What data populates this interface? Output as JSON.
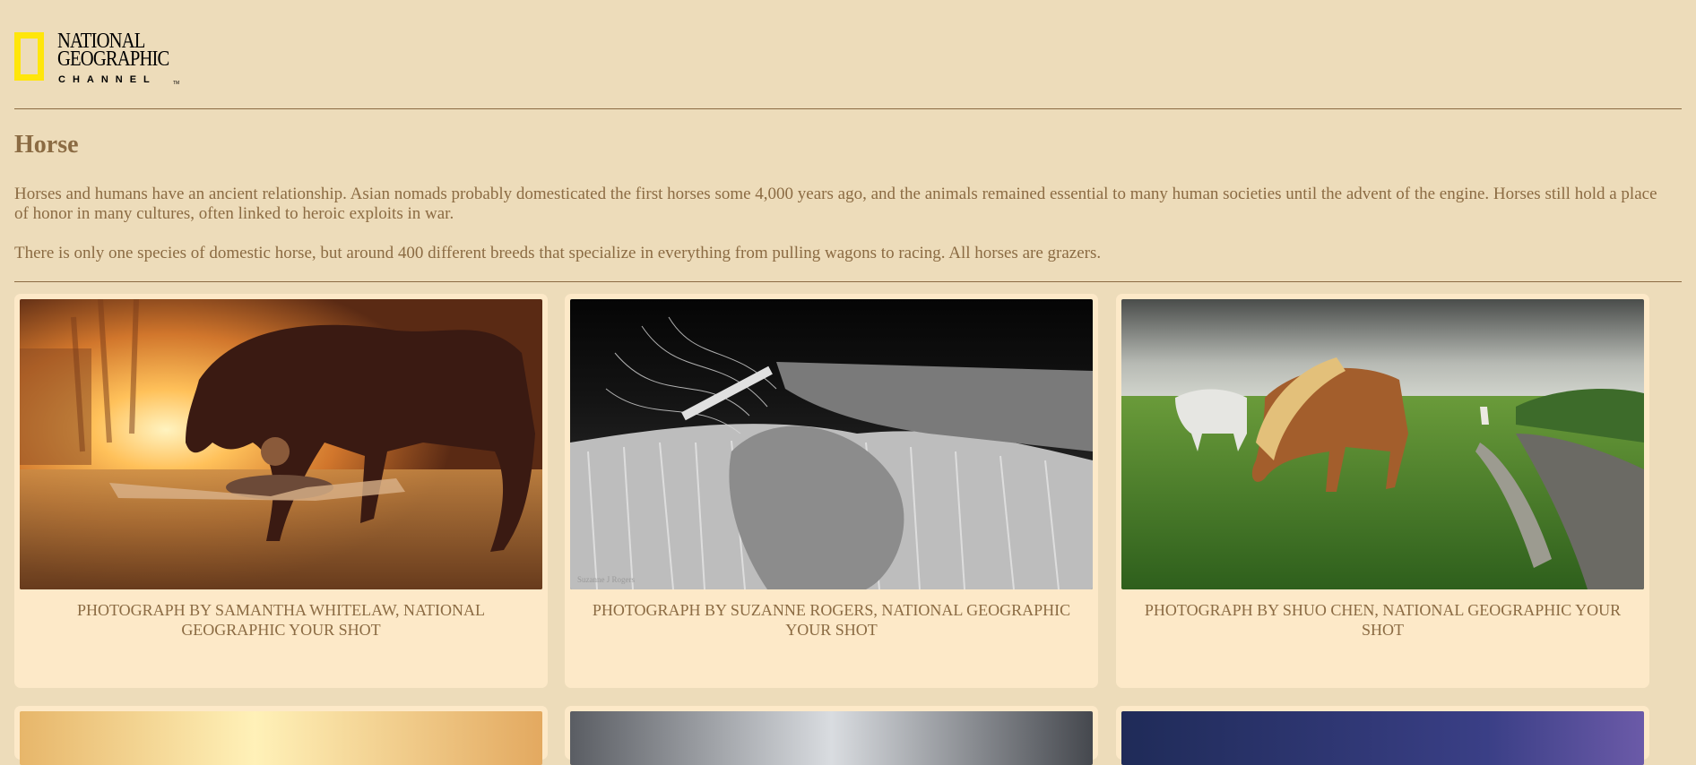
{
  "brand": {
    "line1": "NATIONAL",
    "line2": "GEOGRAPHIC",
    "line3": "CHANNEL",
    "frame_color": "#ffe60a",
    "tm": "TM"
  },
  "header": {
    "title": "Horse"
  },
  "intro": {
    "p1": "Horses and humans have an ancient relationship. Asian nomads probably domesticated the first horses some 4,000 years ago, and the animals remained essential to many human societies until the advent of the engine. Horses still hold a place of honor in many cultures, often linked to heroic exploits in war.",
    "p2": "There is only one species of domestic horse, but around 400 different breeds that specialize in everything from pulling wagons to racing. All horses are grazers."
  },
  "gallery": {
    "cards": [
      {
        "caption": "PHOTOGRAPH BY SAMANTHA WHITELAW, NATIONAL GEOGRAPHIC YOUR SHOT"
      },
      {
        "caption": "PHOTOGRAPH BY SUZANNE ROGERS, NATIONAL GEOGRAPHIC YOUR SHOT",
        "watermark": "Suzanne J Rogers"
      },
      {
        "caption": "PHOTOGRAPH BY SHUO CHEN, NATIONAL GEOGRAPHIC YOUR SHOT"
      }
    ]
  },
  "colors": {
    "background": "#eddcba",
    "card": "#fde9c8",
    "text": "#8b6b43"
  }
}
